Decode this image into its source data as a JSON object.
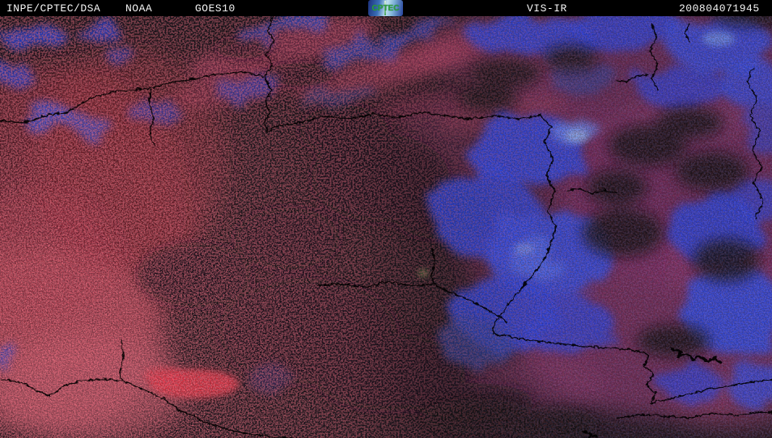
{
  "header": {
    "agency": "INPE/CPTEC/DSA",
    "operator": "NOAA",
    "satellite": "GOES10",
    "logo_text": "CPTEC",
    "product": "VIS-IR",
    "timestamp": "200804071945"
  },
  "scene": {
    "alt": "False-color VIS-IR GOES-10 satellite composite: red speckled low clouds on the left, blue cold cloud tops on the right, black political and river boundary lines"
  },
  "colors": {
    "header-bg": "#000000",
    "header-text": "#f5f5f5",
    "logo-green": "#2f9e3f",
    "base-dark": "#171217",
    "red-speckle": "#c52534",
    "red-bright": "#e23140",
    "pink-cloud": "#c65b6b",
    "magenta-cloud": "#993758",
    "purple-wash": "#7c2f62",
    "blue-cloud": "#2742dc",
    "blue-bright": "#4a6cf0",
    "border-line": "#000000"
  }
}
